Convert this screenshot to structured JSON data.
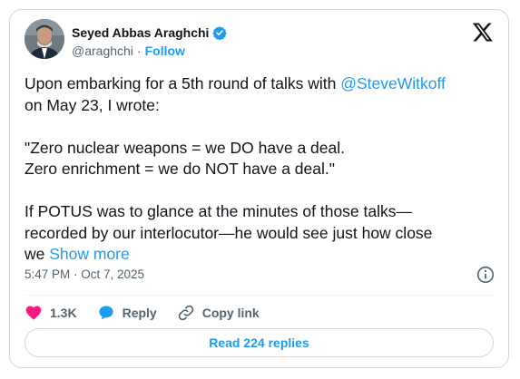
{
  "author": {
    "name": "Seyed Abbas Araghchi",
    "handle": "@araghchi",
    "separator": "·",
    "follow_label": "Follow"
  },
  "icons": {
    "avatar": "user-avatar",
    "verified": "verified-badge-icon",
    "platform": "x-logo-icon",
    "info": "info-icon",
    "like": "heart-icon",
    "reply": "reply-bubble-icon",
    "copy": "link-icon"
  },
  "tweet": {
    "line1_pre": "Upon embarking for a 5th round of talks with ",
    "mention": "@SteveWitkoff",
    "line2": "\non May 23, I wrote:\n\n\"Zero nuclear weapons = we DO have a deal.\nZero enrichment = we do NOT have a deal.\"\n\nIf POTUS was to glance at the minutes of those talks—\nrecorded by our interlocutor—he would see just how close\nwe ",
    "show_more": "Show more"
  },
  "timestamp": "5:47 PM · Oct 7, 2025",
  "actions": {
    "likes": "1.3K",
    "reply_label": "Reply",
    "copy_label": "Copy link"
  },
  "read_replies": "Read 224 replies",
  "colors": {
    "accent": "#1d9bf0",
    "like": "#f91880",
    "text": "#0f1419",
    "muted": "#536471",
    "border": "#cfd9de"
  }
}
